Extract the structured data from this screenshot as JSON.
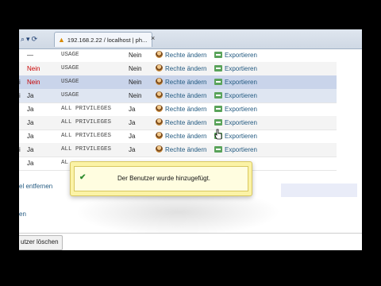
{
  "browser": {
    "tab_title": "192.168.2.22 / localhost | ph...",
    "close_glyph": "×",
    "nav_glyphs": [
      "⌕",
      "▾",
      "⟳"
    ]
  },
  "table": {
    "rows": [
      {
        "host": "",
        "password": "—",
        "password_red": false,
        "privileges": "USAGE",
        "grant": "Nein",
        "rights": "Rechte ändern",
        "export": "Exportieren",
        "style": ""
      },
      {
        "host": "",
        "password": "Nein",
        "password_red": true,
        "privileges": "USAGE",
        "grant": "Nein",
        "rights": "Rechte ändern",
        "export": "Exportieren",
        "style": "alt"
      },
      {
        "host": "i",
        "password": "Nein",
        "password_red": true,
        "privileges": "USAGE",
        "grant": "Nein",
        "rights": "Rechte ändern",
        "export": "Exportieren",
        "style": "sel"
      },
      {
        "host": "i",
        "password": "Ja",
        "password_red": false,
        "privileges": "USAGE",
        "grant": "Nein",
        "rights": "Rechte ändern",
        "export": "Exportieren",
        "style": "hov"
      },
      {
        "host": "",
        "password": "Ja",
        "password_red": false,
        "privileges": "ALL PRIVILEGES",
        "grant": "Ja",
        "rights": "Rechte ändern",
        "export": "Exportieren",
        "style": ""
      },
      {
        "host": "",
        "password": "Ja",
        "password_red": false,
        "privileges": "ALL PRIVILEGES",
        "grant": "Ja",
        "rights": "Rechte ändern",
        "export": "Exportieren",
        "style": "alt"
      },
      {
        "host": "",
        "password": "Ja",
        "password_red": false,
        "privileges": "ALL PRIVILEGES",
        "grant": "Ja",
        "rights": "Rechte ändern",
        "export": "Exportieren",
        "style": ""
      },
      {
        "host": "i",
        "password": "Ja",
        "password_red": false,
        "privileges": "ALL PRIVILEGES",
        "grant": "Ja",
        "rights": "Rechte ändern",
        "export": "Exportieren",
        "style": "alt"
      },
      {
        "host": "",
        "password": "Ja",
        "password_red": false,
        "privileges": "AL",
        "grant": "",
        "rights": "",
        "export": "",
        "style": ""
      }
    ]
  },
  "links": {
    "remove_label": "el entfernen",
    "partial_label": "en"
  },
  "toast": {
    "message": "Der Benutzer wurde hinzugefügt."
  },
  "footer": {
    "delete_users_label": "utzer löschen"
  },
  "colors": {
    "link": "#235a81",
    "red": "#c80000",
    "toast_bg": "#fbf3a6",
    "selected_row": "#c9d4ea"
  }
}
